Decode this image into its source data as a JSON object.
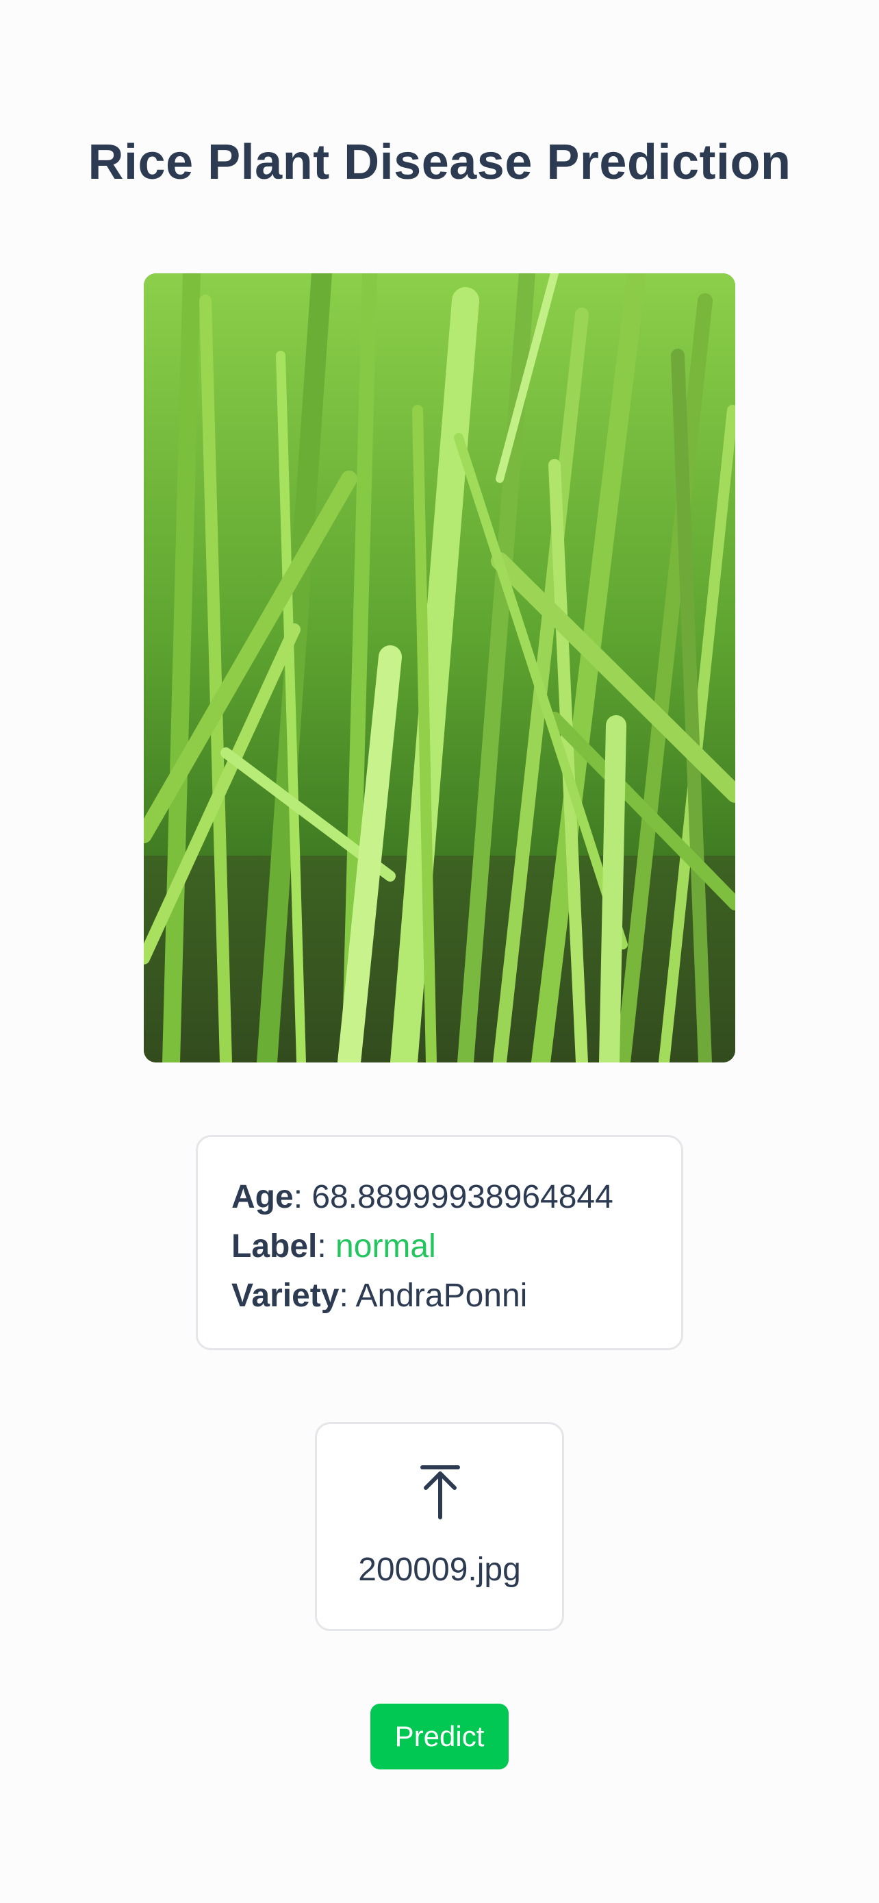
{
  "page": {
    "title": "Rice Plant Disease Prediction"
  },
  "image": {
    "description": "Photo of green rice plant leaves"
  },
  "result": {
    "age_label": "Age",
    "age_value": "68.88999938964844",
    "label_label": "Label",
    "label_value": "normal",
    "variety_label": "Variety",
    "variety_value": "AndraPonni",
    "separator": ": "
  },
  "upload": {
    "icon": "upload-icon",
    "file_name": "200009.jpg"
  },
  "actions": {
    "predict_label": "Predict"
  },
  "colors": {
    "text": "#2d3b52",
    "accent": "#00c853",
    "label_value": "#22c55e",
    "border": "#e4e6ea"
  }
}
